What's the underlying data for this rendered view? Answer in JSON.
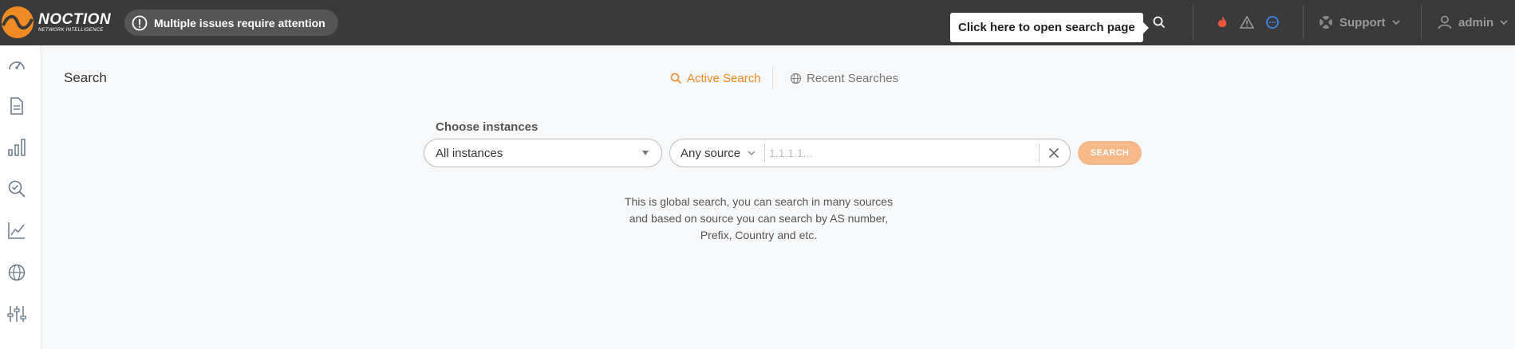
{
  "header": {
    "logo": {
      "name": "NOCTION",
      "tagline": "NETWORK INTELLIGENCE"
    },
    "alert": {
      "text": "Multiple issues require attention",
      "icon": "exclamation-circle-icon"
    },
    "search_tooltip": "Click here to open search page",
    "icons": {
      "search": "search-icon",
      "fire": "fire-icon",
      "warning": "warning-triangle-icon",
      "chat": "chat-bubble-icon"
    },
    "support_label": "Support",
    "user_label": "admin",
    "colors": {
      "bar": "#3a3a3a",
      "fire": "#e8553a",
      "chat": "#3f83e8"
    }
  },
  "sidebar": {
    "items": [
      {
        "name": "dashboard",
        "icon": "speedometer-icon"
      },
      {
        "name": "reports",
        "icon": "document-icon"
      },
      {
        "name": "statistics",
        "icon": "bar-chart-icon"
      },
      {
        "name": "search",
        "icon": "search-check-icon"
      },
      {
        "name": "analytics",
        "icon": "line-chart-icon"
      },
      {
        "name": "network",
        "icon": "globe-icon"
      },
      {
        "name": "settings",
        "icon": "sliders-icon"
      }
    ]
  },
  "main": {
    "title": "Search",
    "tabs": [
      {
        "label": "Active Search",
        "icon": "search-icon",
        "active": true
      },
      {
        "label": "Recent Searches",
        "icon": "globe-icon",
        "active": false
      }
    ],
    "choose_label": "Choose instances",
    "instances_value": "All instances",
    "source_value": "Any source",
    "search_placeholder": "1.1.1.1...",
    "search_button": "SEARCH",
    "help_text": "This is global search, you can search in many sources and based on source you can search by AS number, Prefix, Country and etc.",
    "accent_color": "#f08a24"
  }
}
